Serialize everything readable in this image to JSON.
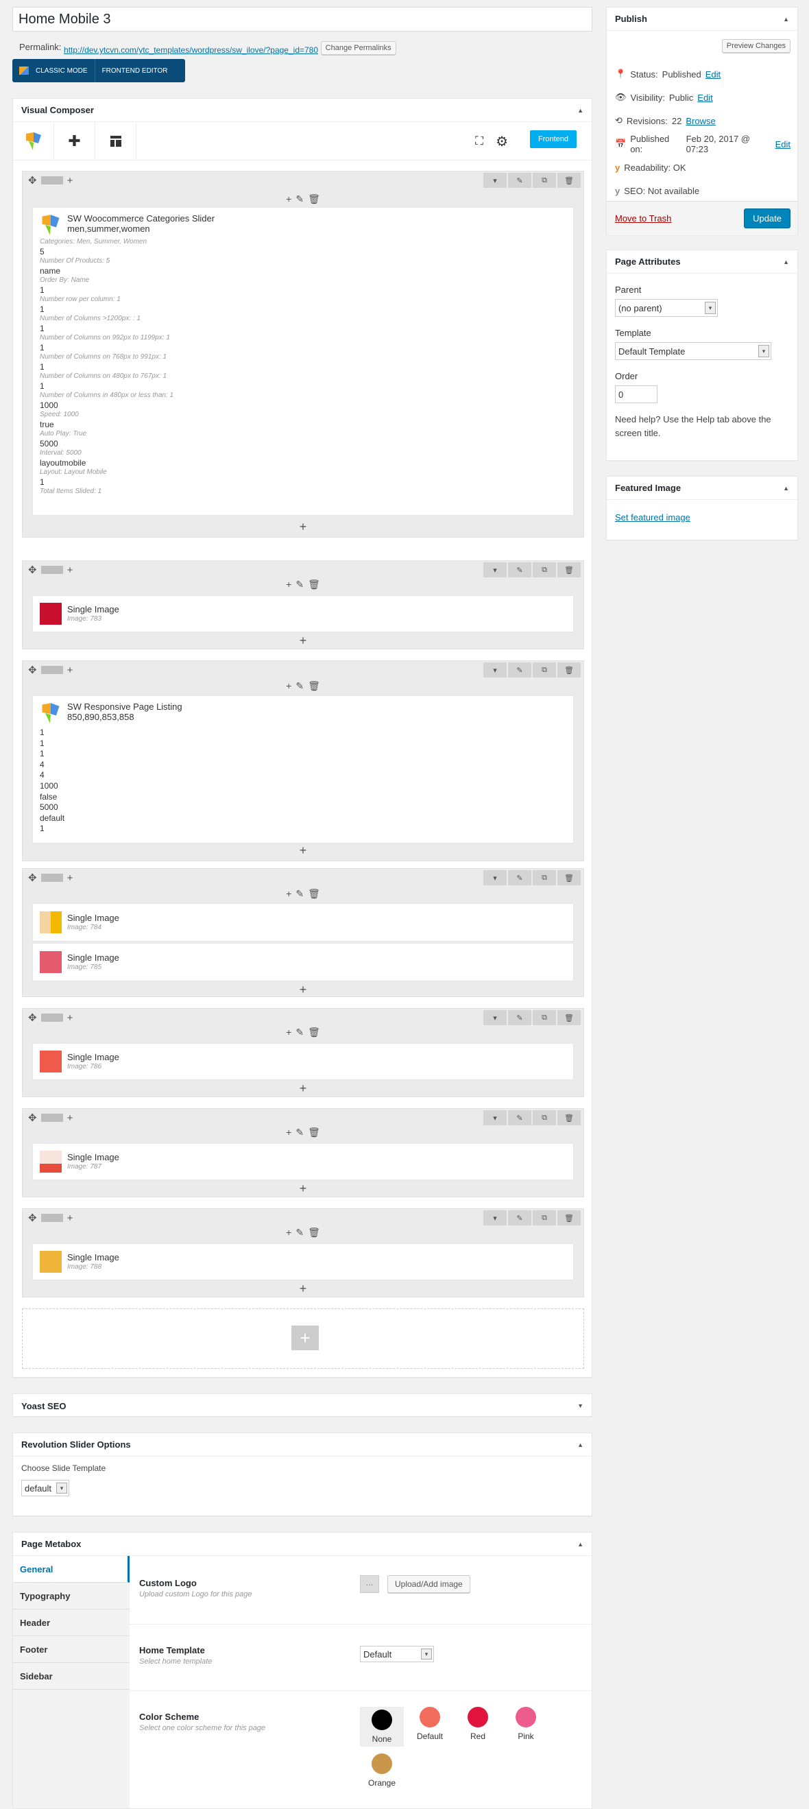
{
  "title": "Home Mobile 3",
  "permalink": {
    "label": "Permalink:",
    "url": "http://dev.ytcvn.com/ytc_templates/wordpress/sw_ilove/?page_id=780",
    "button": "Change Permalinks"
  },
  "vc_switch": {
    "classic": "CLASSIC MODE",
    "frontend": "FRONTEND EDITOR"
  },
  "vc": {
    "title": "Visual Composer",
    "frontend_btn": "Frontend"
  },
  "slider": {
    "name": "SW Woocommerce Categories Slider",
    "subtitle": "men,summer,women",
    "params": [
      {
        "lbl": "Categories: Men, Summer, Women",
        "val": "5"
      },
      {
        "lbl": "Number Of Products: 5",
        "val": "name"
      },
      {
        "lbl": "Order By: Name",
        "val": "1"
      },
      {
        "lbl": "Number row per column: 1",
        "val": "1"
      },
      {
        "lbl": "Number of Columns >1200px: : 1",
        "val": "1"
      },
      {
        "lbl": "Number of Columns on 992px to 1199px: 1",
        "val": "1"
      },
      {
        "lbl": "Number of Columns on 768px to 991px: 1",
        "val": "1"
      },
      {
        "lbl": "Number of Columns on 480px to 767px: 1",
        "val": "1"
      },
      {
        "lbl": "Number of Columns in 480px or less than: 1",
        "val": "1000"
      },
      {
        "lbl": "Speed: 1000",
        "val": "true"
      },
      {
        "lbl": "Auto Play: True",
        "val": "5000"
      },
      {
        "lbl": "Interval: 5000",
        "val": "layoutmobile"
      },
      {
        "lbl": "Layout: Layout Mobile",
        "val": "1"
      },
      {
        "lbl": "Total Items Slided: 1",
        "val": ""
      }
    ]
  },
  "single_image_label": "Single Image",
  "images": {
    "i783": "Image: 783",
    "i784": "Image: 784",
    "i785": "Image: 785",
    "i786": "Image: 786",
    "i787": "Image: 787",
    "i788": "Image: 788"
  },
  "listing": {
    "name": "SW Responsive Page Listing",
    "subtitle": "850,890,853,858",
    "values": [
      "1",
      "1",
      "1",
      "4",
      "4",
      "1000",
      "false",
      "5000",
      "default",
      "1"
    ]
  },
  "yoast": {
    "title": "Yoast SEO"
  },
  "rev": {
    "title": "Revolution Slider Options",
    "label": "Choose Slide Template",
    "value": "default"
  },
  "metabox": {
    "title": "Page Metabox",
    "tabs": [
      "General",
      "Typography",
      "Header",
      "Footer",
      "Sidebar"
    ],
    "custom_logo": {
      "title": "Custom Logo",
      "desc": "Upload custom Logo for this page",
      "button": "Upload/Add image",
      "remove": "..."
    },
    "home_template": {
      "title": "Home Template",
      "desc": "Select home template",
      "value": "Default"
    },
    "color_scheme": {
      "title": "Color Scheme",
      "desc": "Select one color scheme for this page",
      "options": [
        {
          "name": "None",
          "color": "#000000"
        },
        {
          "name": "Default",
          "color": "#f26c5b"
        },
        {
          "name": "Red",
          "color": "#e0143c"
        },
        {
          "name": "Pink",
          "color": "#ec5d8e"
        },
        {
          "name": "Orange",
          "color": "#c8974a"
        }
      ]
    }
  },
  "publish": {
    "title": "Publish",
    "preview": "Preview Changes",
    "status_label": "Status:",
    "status": "Published",
    "visibility_label": "Visibility:",
    "visibility": "Public",
    "revisions_label": "Revisions:",
    "revisions": "22",
    "browse": "Browse",
    "published_label": "Published on:",
    "published": "Feb 20, 2017 @ 07:23",
    "edit": "Edit",
    "readability": "Readability: OK",
    "seo": "SEO: Not available",
    "trash": "Move to Trash",
    "update": "Update"
  },
  "attributes": {
    "title": "Page Attributes",
    "parent_label": "Parent",
    "parent": "(no parent)",
    "template_label": "Template",
    "template": "Default Template",
    "order_label": "Order",
    "order": "0",
    "help": "Need help? Use the Help tab above the screen title."
  },
  "featured": {
    "title": "Featured Image",
    "link": "Set featured image"
  }
}
